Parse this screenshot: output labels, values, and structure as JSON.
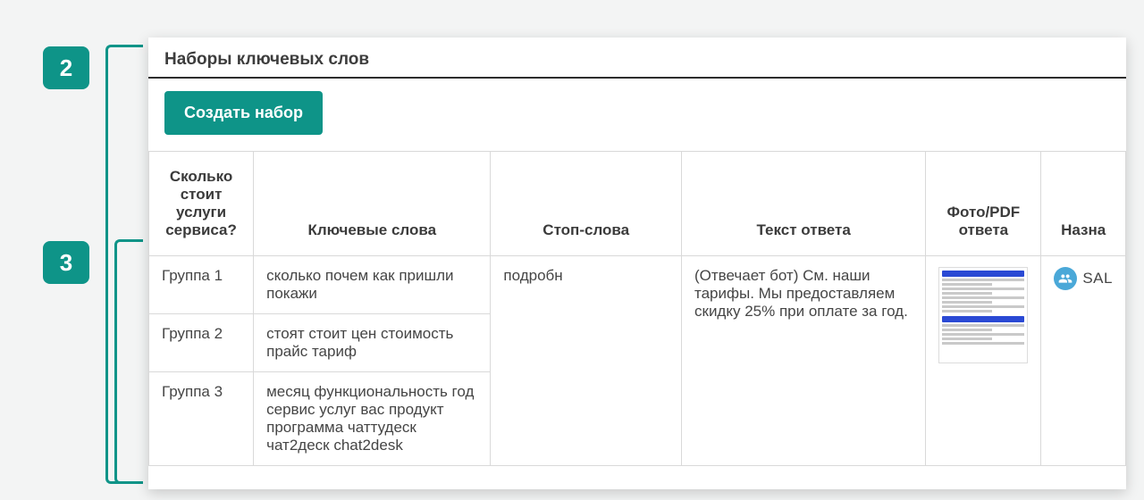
{
  "steps": {
    "two": "2",
    "three": "3"
  },
  "section": {
    "title": "Наборы ключевых слов"
  },
  "toolbar": {
    "create_label": "Создать набор"
  },
  "table": {
    "headers": {
      "name": "Сколько стоит услуги сервиса?",
      "keywords": "Ключевые слова",
      "stopwords": "Стоп-слова",
      "answer": "Текст ответа",
      "photo": "Фото/PDF ответа",
      "assigned": "Назна"
    },
    "stopwords": "подробн",
    "answer": "(Отвечает бот) См. наши тарифы. Мы предоставляем скидку 25% при оплате за год.",
    "assignee": {
      "label": "SAL"
    },
    "rows": [
      {
        "name": "Группа 1",
        "keywords": "сколько почем как пришли покажи"
      },
      {
        "name": "Группа 2",
        "keywords": "стоят стоит цен стоимость прайс тариф"
      },
      {
        "name": "Группа 3",
        "keywords": "месяц функциональность год сервис услуг вас продукт программа чаттудеск чат2деск chat2desk"
      }
    ]
  }
}
